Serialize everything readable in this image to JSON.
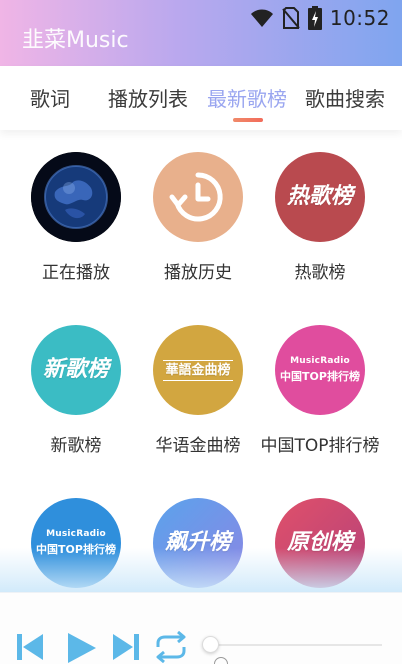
{
  "status_bar": {
    "time": "10:52",
    "icons": [
      "wifi-icon",
      "no-sim-icon",
      "battery-charging-icon"
    ]
  },
  "header": {
    "title": "韭菜Music"
  },
  "tabs": [
    {
      "label": "歌词",
      "active": false
    },
    {
      "label": "播放列表",
      "active": false
    },
    {
      "label": "最新歌榜",
      "active": true
    },
    {
      "label": "歌曲搜索",
      "active": false
    }
  ],
  "charts": [
    {
      "label": "正在播放",
      "badge": "",
      "icon": "earth-disc-icon",
      "color": "#0b1a3a"
    },
    {
      "label": "播放历史",
      "badge": "",
      "icon": "history-clock-icon",
      "color": "#e8b08c"
    },
    {
      "label": "热歌榜",
      "badge": "热歌榜",
      "icon": "hot-chart-icon",
      "color": "#b94a4f"
    },
    {
      "label": "新歌榜",
      "badge": "新歌榜",
      "icon": "new-chart-icon",
      "color": "#3bbcc4"
    },
    {
      "label": "华语金曲榜",
      "badge": "華語金曲榜",
      "icon": "chinese-gold-chart-icon",
      "color": "#d2a640"
    },
    {
      "label": "中国TOP排行榜",
      "badge": "MusicRadio|中国TOP排行榜",
      "icon": "china-top-chart-icon",
      "color": "#e04d9e"
    },
    {
      "label": "",
      "badge": "MusicRadio|中国TOP排行榜",
      "icon": "musicradio-chart-icon",
      "color": "#2f8fdc"
    },
    {
      "label": "",
      "badge": "飙升榜",
      "icon": "rising-chart-icon",
      "color": "#6f8ee8"
    },
    {
      "label": "",
      "badge": "原创榜",
      "icon": "original-chart-icon",
      "color": "#cc4a6e"
    }
  ],
  "player": {
    "controls": [
      "previous-icon",
      "play-icon",
      "next-icon",
      "repeat-icon"
    ],
    "progress": 0
  },
  "colors": {
    "accent": "#9aa6f0",
    "indicator": "#f26b5a",
    "control": "#5cb8e8"
  }
}
